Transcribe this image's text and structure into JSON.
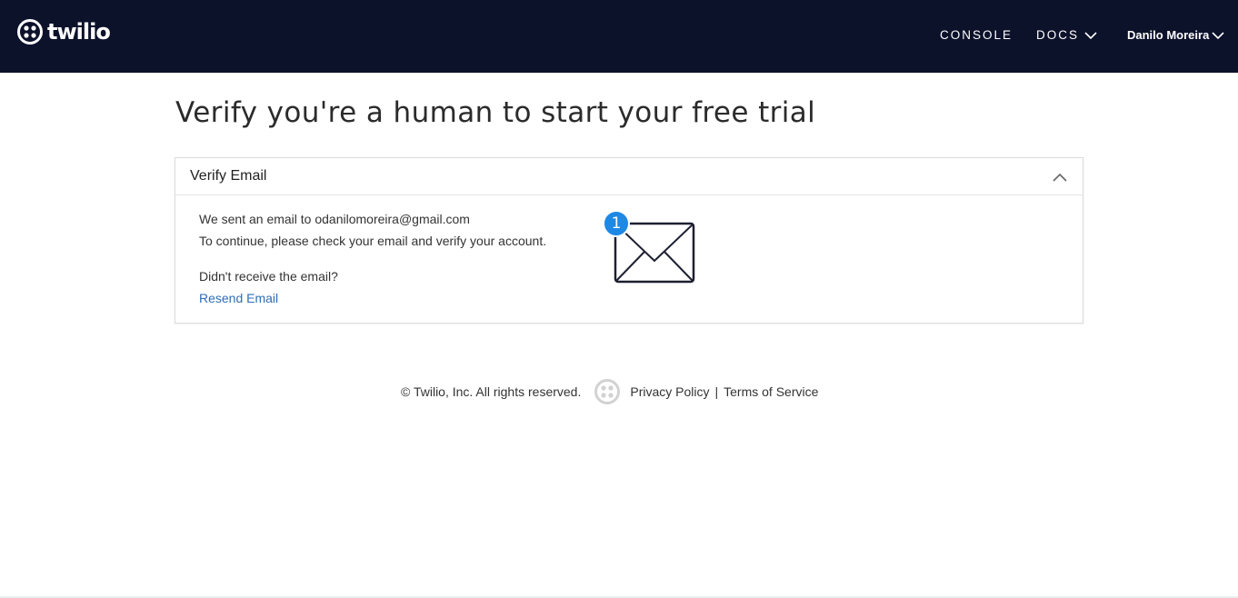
{
  "header": {
    "brand": "twilio",
    "nav": {
      "console": "CONSOLE",
      "docs": "DOCS",
      "user": "Danilo Moreira"
    }
  },
  "main": {
    "title": "Verify you're a human to start your free trial",
    "panel": {
      "title": "Verify Email",
      "sent_line": "We sent an email to odanilomoreira@gmail.com",
      "continue_line": "To continue, please check your email and verify your account.",
      "not_received": "Didn't receive the email?",
      "resend_label": "Resend Email",
      "badge_count": "1"
    }
  },
  "footer": {
    "copyright": "© Twilio, Inc. All rights reserved.",
    "privacy": "Privacy Policy",
    "separator": "|",
    "terms": "Terms of Service"
  },
  "colors": {
    "topbar": "#0d122b",
    "link": "#2f6db5",
    "badge": "#1e88e5"
  },
  "icons": {
    "logo": "twilio-logo-icon",
    "collapse": "chevron-up-icon",
    "dropdown": "chevron-down-icon",
    "mail": "envelope-icon"
  }
}
